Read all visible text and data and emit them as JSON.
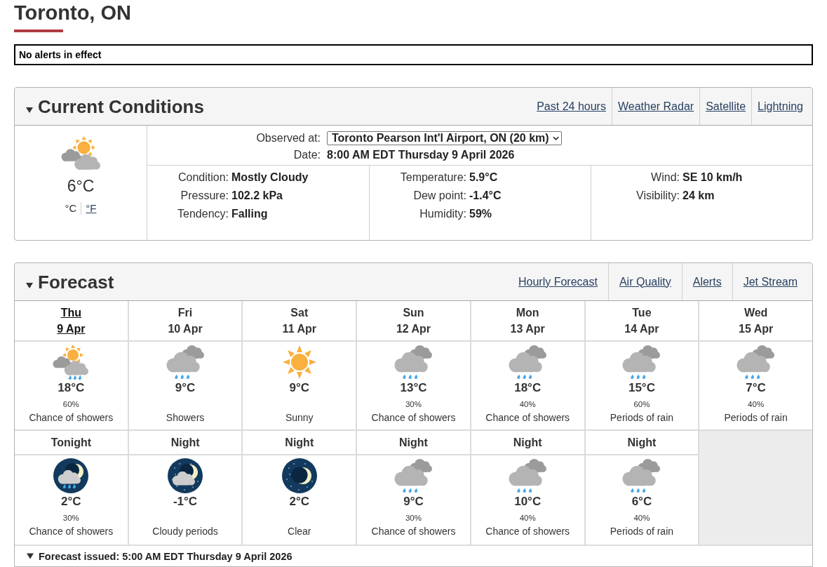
{
  "page_title": "Toronto, ON",
  "alert_banner": "No alerts in effect",
  "current_conditions": {
    "title": "Current Conditions",
    "links": [
      "Past 24 hours",
      "Weather Radar",
      "Satellite",
      "Lightning"
    ],
    "temperature": "6°C",
    "units": [
      {
        "label": "°C",
        "selected": true
      },
      {
        "label": "°F",
        "selected": false
      }
    ],
    "observed_at": {
      "label": "Observed at:",
      "value": "Toronto Pearson Int'l Airport, ON (20 km)"
    },
    "date": {
      "label": "Date:",
      "value": "8:00 AM EDT Thursday 9 April 2026"
    },
    "detail_columns": [
      {
        "rows": [
          {
            "label": "Condition:",
            "value": "Mostly Cloudy"
          },
          {
            "label": "Pressure:",
            "value": "102.2 kPa"
          },
          {
            "label": "Tendency:",
            "value": "Falling"
          }
        ]
      },
      {
        "rows": [
          {
            "label": "Temperature:",
            "value": "5.9°C"
          },
          {
            "label": "Dew point:",
            "value": "-1.4°C"
          },
          {
            "label": "Humidity:",
            "value": "59%"
          }
        ]
      },
      {
        "rows": [
          {
            "label": "Wind:",
            "value": "SE 10 km/h"
          },
          {
            "label": "Visibility:",
            "value": "24 km"
          }
        ]
      }
    ]
  },
  "forecast": {
    "title": "Forecast",
    "links": [
      "Hourly Forecast",
      "Air Quality",
      "Alerts",
      "Jet Stream"
    ],
    "days": [
      {
        "day": "Thu",
        "date": "9 Apr",
        "selected": true,
        "kind": "sunshowers",
        "temperature": "18°C",
        "pop": "60%",
        "summary": "Chance of showers"
      },
      {
        "day": "Fri",
        "date": "10 Apr",
        "selected": false,
        "kind": "rain",
        "temperature": "9°C",
        "summary": "Showers"
      },
      {
        "day": "Sat",
        "date": "11 Apr",
        "selected": false,
        "kind": "sunny",
        "temperature": "9°C",
        "summary": "Sunny"
      },
      {
        "day": "Sun",
        "date": "12 Apr",
        "selected": false,
        "kind": "rain",
        "temperature": "13°C",
        "pop": "30%",
        "summary": "Chance of showers"
      },
      {
        "day": "Mon",
        "date": "13 Apr",
        "selected": false,
        "kind": "rain",
        "temperature": "18°C",
        "pop": "40%",
        "summary": "Chance of showers"
      },
      {
        "day": "Tue",
        "date": "14 Apr",
        "selected": false,
        "kind": "rain",
        "temperature": "15°C",
        "pop": "60%",
        "summary": "Periods of rain"
      },
      {
        "day": "Wed",
        "date": "15 Apr",
        "selected": false,
        "kind": "rain",
        "temperature": "7°C",
        "pop": "40%",
        "summary": "Periods of rain"
      }
    ],
    "nights": [
      {
        "label": "Tonight",
        "kind": "nightrain",
        "temperature": "2°C",
        "pop": "30%",
        "summary": "Chance of showers"
      },
      {
        "label": "Night",
        "kind": "nightcloud",
        "temperature": "-1°C",
        "summary": "Cloudy periods"
      },
      {
        "label": "Night",
        "kind": "clear",
        "temperature": "2°C",
        "summary": "Clear"
      },
      {
        "label": "Night",
        "kind": "rain",
        "temperature": "9°C",
        "pop": "30%",
        "summary": "Chance of showers"
      },
      {
        "label": "Night",
        "kind": "rain",
        "temperature": "10°C",
        "pop": "40%",
        "summary": "Chance of showers"
      },
      {
        "label": "Night",
        "kind": "rain",
        "temperature": "6°C",
        "pop": "40%",
        "summary": "Periods of rain"
      }
    ],
    "issued": "Forecast issued: 5:00 AM EDT Thursday 9 April 2026"
  }
}
